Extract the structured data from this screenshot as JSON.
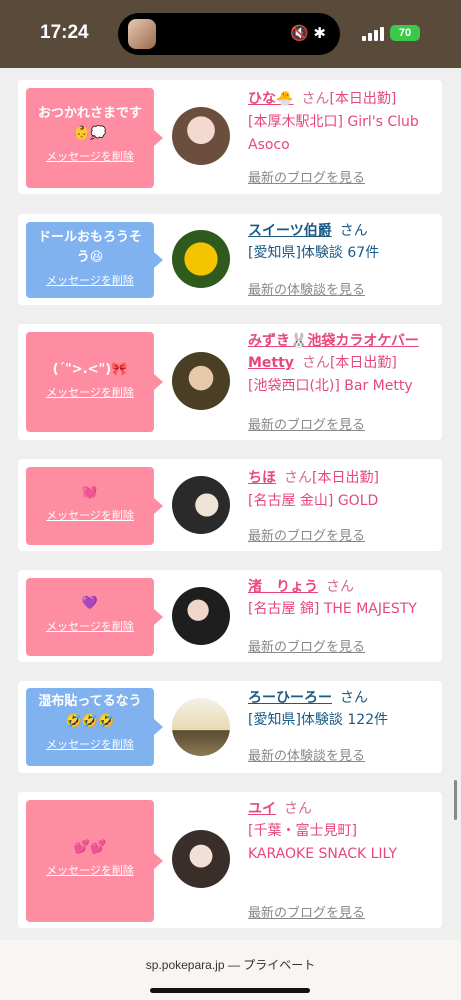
{
  "status_bar": {
    "time": "17:24",
    "battery": "70",
    "colors": {
      "background": "#5a4a3a",
      "battery": "#3cc84b"
    }
  },
  "cards": [
    {
      "name": "ひな🐣",
      "san": "さん",
      "status": "[本日出勤]",
      "detail": "[本厚木駅北口] Girl's Club Asoco",
      "link": "最新のブログを見る",
      "message": "おつかれさまです👶💭",
      "delete": "メッセージを削除",
      "bubble_color": "pink",
      "name_color": "pink"
    },
    {
      "name": "スイーツ伯爵",
      "san": "さん",
      "status": "",
      "detail": "[愛知県]体験談 67件",
      "link": "最新の体験談を見る",
      "message": "ドールおもろうそう😆",
      "delete": "メッセージを削除",
      "bubble_color": "blue",
      "name_color": "blue"
    },
    {
      "name": "みずき🐰池袋カラオケバーMetty",
      "san": "さん",
      "status": "[本日出勤]",
      "detail": "[池袋西口(北)] Bar Metty",
      "link": "最新のブログを見る",
      "message": "(´\">.<\")🎀",
      "delete": "メッセージを削除",
      "bubble_color": "pink",
      "name_color": "pink"
    },
    {
      "name": "ちほ",
      "san": "さん",
      "status": "[本日出勤]",
      "detail": "[名古屋 金山] GOLD",
      "link": "最新のブログを見る",
      "message": "💓",
      "delete": "メッセージを削除",
      "bubble_color": "pink",
      "name_color": "pink"
    },
    {
      "name": "渚　りょう",
      "san": "さん",
      "status": "",
      "detail": "[名古屋 錦] THE MAJESTY",
      "link": "最新のブログを見る",
      "message": "💜",
      "delete": "メッセージを削除",
      "bubble_color": "pink",
      "name_color": "pink"
    },
    {
      "name": "ろーひーろー",
      "san": "さん",
      "status": "",
      "detail": "[愛知県]体験談 122件",
      "link": "最新の体験談を見る",
      "message": "湿布貼ってるなう🤣🤣🤣",
      "delete": "メッセージを削除",
      "bubble_color": "blue",
      "name_color": "blue"
    },
    {
      "name": "ユイ",
      "san": "さん",
      "status": "",
      "detail": "[千葉・富士見町] KARAOKE SNACK LILY",
      "link": "最新のブログを見る",
      "message": "💕💕",
      "delete": "メッセージを削除",
      "bubble_color": "pink",
      "name_color": "pink"
    }
  ],
  "browser": {
    "url": "sp.pokepara.jp",
    "mode": "— プライベート"
  }
}
